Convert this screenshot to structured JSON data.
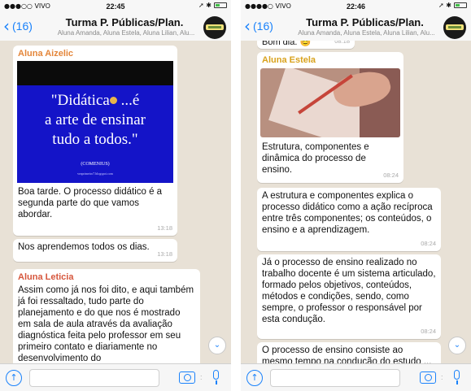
{
  "left": {
    "status": {
      "carrier": "●●●○○ VIVO",
      "time": "22:45",
      "icons": "➚ ✱"
    },
    "header": {
      "back_count": "(16)",
      "title": "Turma P. Públicas/Plan.",
      "members": "Aluna Amanda, Aluna Estela, Aluna Lilian, Alu..."
    },
    "messages": [
      {
        "sender": "Aluna Aizelic",
        "image": {
          "line1": "\"Didática",
          "line1b": "...é",
          "line2": "a arte de ensinar",
          "line3": "tudo a todos.\"",
          "author": "(COMENIUS)",
          "blog": "vrnprimeiro7.blogspot.com"
        },
        "text": "Boa tarde. O processo didático é a segunda parte do que vamos abordar.",
        "time": "13:18"
      },
      {
        "text": "Nos aprendemos todos os dias.",
        "time": "13:18"
      },
      {
        "sender": "Aluna Leticia",
        "text": "Assim como já nos foi dito, e aqui também já foi ressaltado, tudo parte do planejamento e do que nos é mostrado em sala de aula através da avaliação diagnóstica feita pelo professor em seu primeiro contato e diariamente no desenvolvimento do"
      }
    ]
  },
  "right": {
    "status": {
      "carrier": "●●●●○ VIVO",
      "time": "22:46",
      "icons": "➚ ✱"
    },
    "header": {
      "back_count": "(16)",
      "title": "Turma P. Públicas/Plan.",
      "members": "Aluna Amanda, Aluna Estela, Aluna Lilian, Alu..."
    },
    "messages": [
      {
        "text": "Bom dia. 😊",
        "time": "08:18"
      },
      {
        "sender": "Aluna Estela",
        "text": "Estrutura, componentes e dinâmica do processo de ensino.",
        "time": "08:24"
      },
      {
        "text": "A estrutura e componentes explica o processo didático como a ação recíproca entre três componentes; os conteúdos, o ensino e a aprendizagem.",
        "time": "08:24"
      },
      {
        "text": "Já o processo de ensino realizado no trabalho docente é um sistema articulado, formado pelos objetivos, conteúdos, métodos e condições, sendo, como sempre, o professor o responsável por esta condução.",
        "time": "08:24"
      },
      {
        "text": "O processo de ensino consiste ao mesmo tempo na condução do estudo ... atividade ... do aluno"
      }
    ]
  },
  "icons": {
    "back": "chevron-left-icon",
    "scroll": "chevron-down-icon",
    "upload": "arrow-up-icon",
    "camera": "camera-icon",
    "mic": "microphone-icon"
  },
  "colors": {
    "accent": "#1a82fb",
    "chat_bg": "#e8e1d6",
    "sender_aizelic": "#e4863a",
    "sender_estela": "#d9a21d",
    "sender_leticia": "#d6563c",
    "quote_bg": "#1414c8"
  }
}
